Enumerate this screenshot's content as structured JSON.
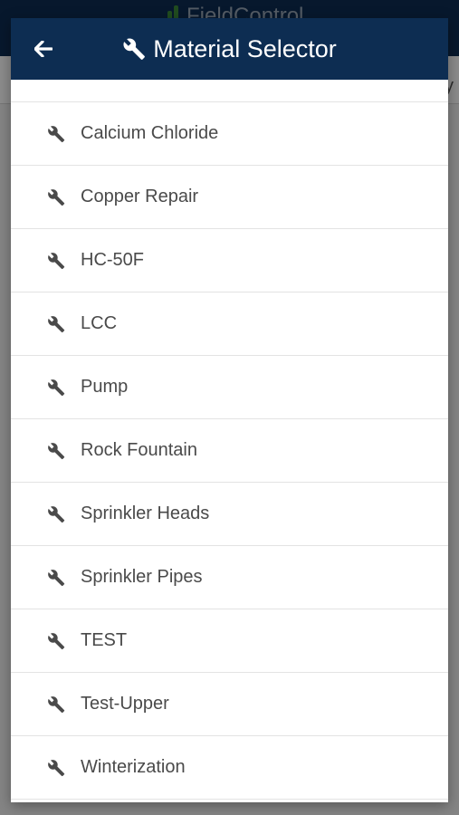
{
  "background": {
    "logo_text": "FieldControl",
    "edge_text": "y"
  },
  "modal": {
    "title": "Material Selector",
    "back_icon": "arrow-left-icon",
    "title_icon": "wrench-icon",
    "header_color": "#0d2d52"
  },
  "materials": [
    {
      "label": "Calcium Chloride",
      "icon": "wrench-icon"
    },
    {
      "label": "Copper Repair",
      "icon": "wrench-icon"
    },
    {
      "label": "HC-50F",
      "icon": "wrench-icon"
    },
    {
      "label": "LCC",
      "icon": "wrench-icon"
    },
    {
      "label": "Pump",
      "icon": "wrench-icon"
    },
    {
      "label": "Rock Fountain",
      "icon": "wrench-icon"
    },
    {
      "label": "Sprinkler Heads",
      "icon": "wrench-icon"
    },
    {
      "label": "Sprinkler Pipes",
      "icon": "wrench-icon"
    },
    {
      "label": "TEST",
      "icon": "wrench-icon"
    },
    {
      "label": "Test-Upper",
      "icon": "wrench-icon"
    },
    {
      "label": "Winterization",
      "icon": "wrench-icon"
    }
  ]
}
